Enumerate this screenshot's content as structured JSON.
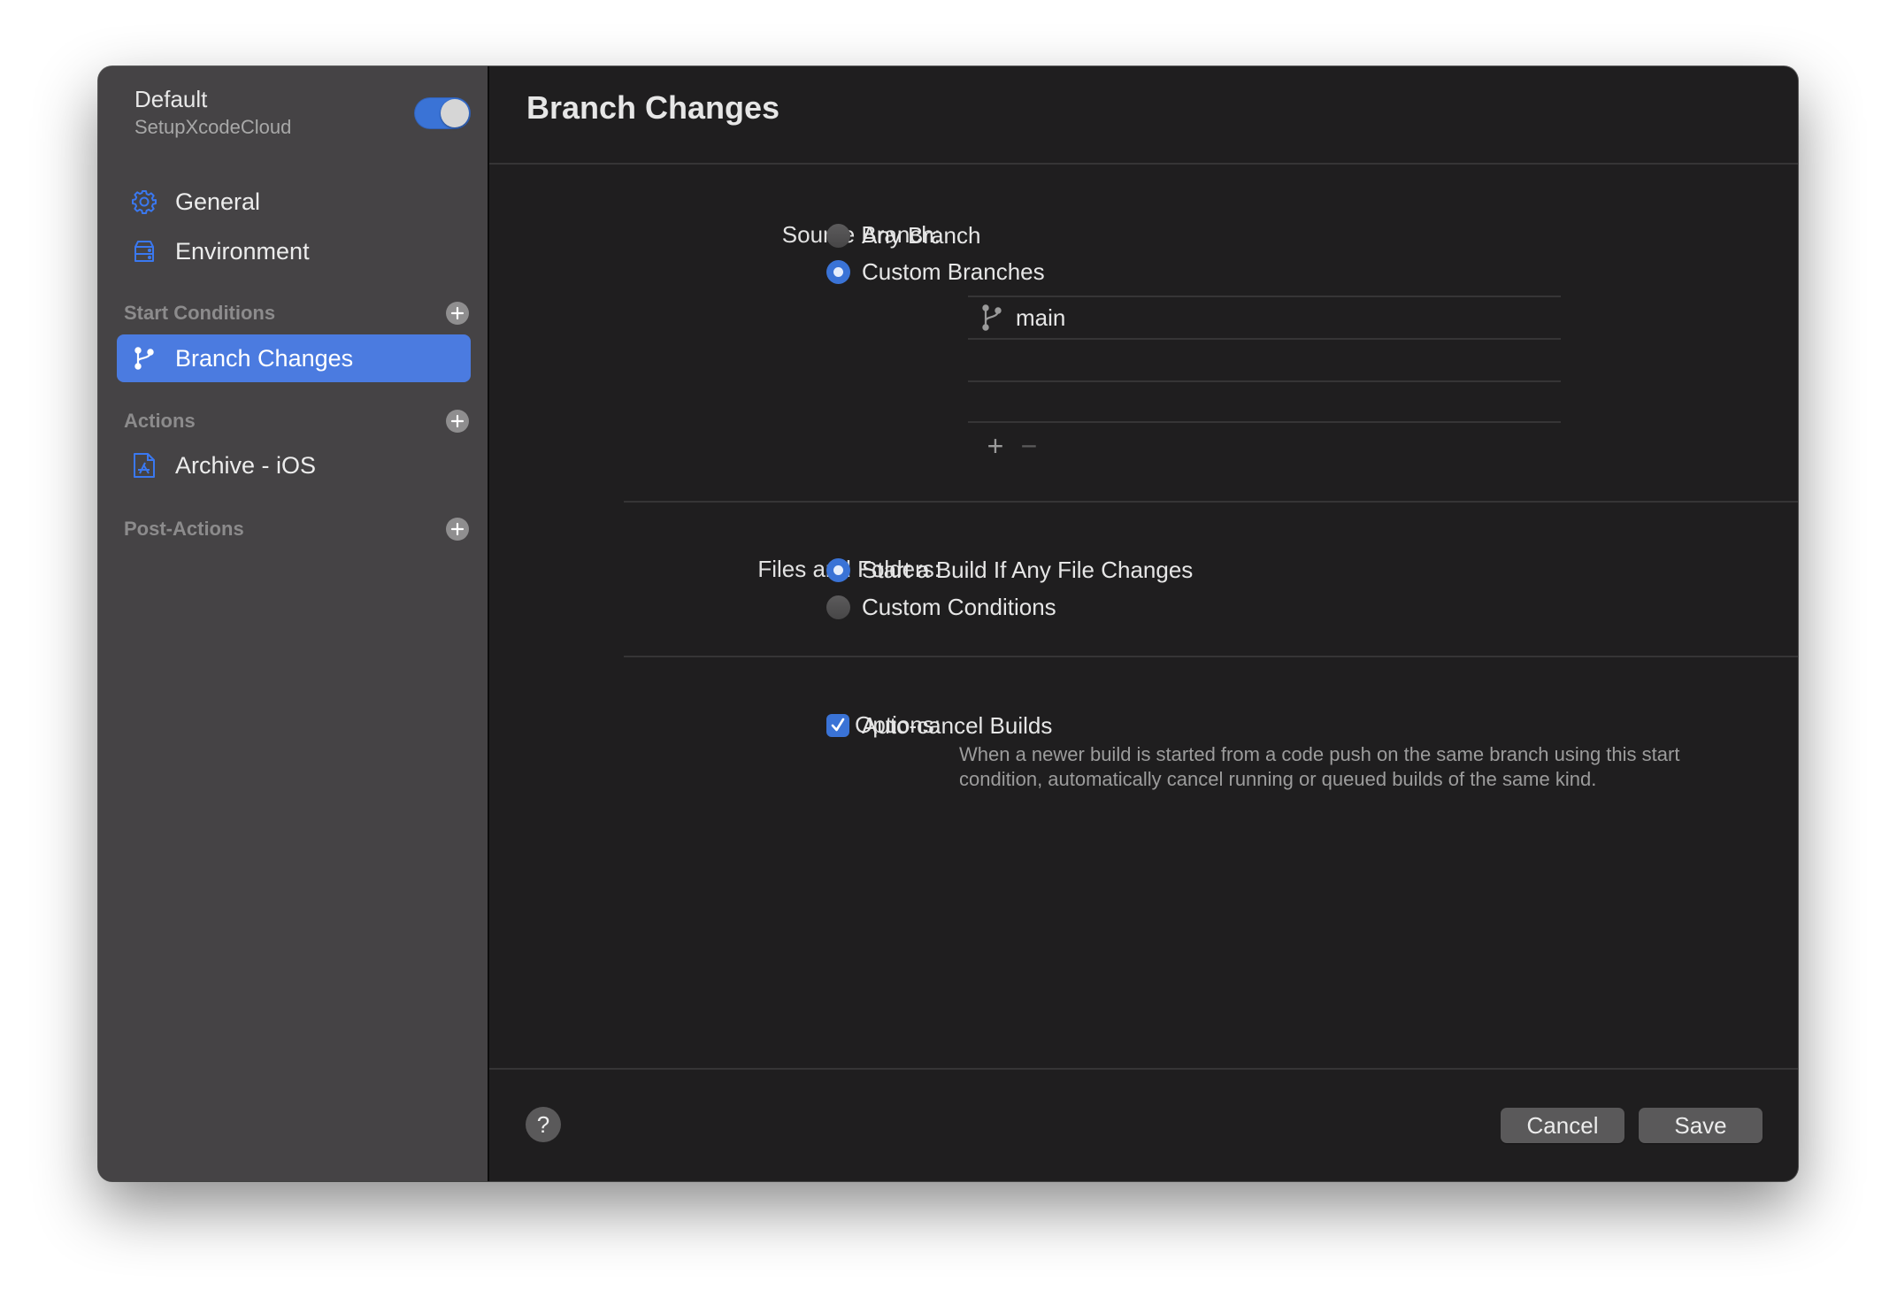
{
  "sidebar": {
    "workflow_name": "Default",
    "product_name": "SetupXcodeCloud",
    "workflow_enabled": true,
    "items": [
      {
        "label": "General",
        "icon": "gear-icon"
      },
      {
        "label": "Environment",
        "icon": "server-icon"
      }
    ],
    "sections": [
      {
        "title": "Start Conditions",
        "items": [
          {
            "label": "Branch Changes",
            "icon": "branch-icon",
            "selected": true
          }
        ]
      },
      {
        "title": "Actions",
        "items": [
          {
            "label": "Archive - iOS",
            "icon": "app-store-document-icon"
          }
        ]
      },
      {
        "title": "Post-Actions",
        "items": []
      }
    ],
    "accent_color": "#4b7be0"
  },
  "main": {
    "title": "Branch Changes",
    "source_branch": {
      "label": "Source Branch:",
      "options": [
        {
          "label": "Any Branch",
          "selected": false
        },
        {
          "label": "Custom Branches",
          "selected": true
        }
      ],
      "branches": [
        "main",
        "",
        ""
      ],
      "add_label": "+",
      "remove_label": "−"
    },
    "files_and_folders": {
      "label": "Files and Folders:",
      "options": [
        {
          "label": "Start a Build If Any File Changes",
          "selected": true
        },
        {
          "label": "Custom Conditions",
          "selected": false
        }
      ]
    },
    "options": {
      "label": "Options:",
      "auto_cancel": {
        "label": "Auto-cancel Builds",
        "checked": true,
        "description": "When a newer build is started from a code push on the same branch using this start condition, automatically cancel running or queued builds of the same kind."
      }
    }
  },
  "footer": {
    "help_label": "?",
    "cancel_label": "Cancel",
    "save_label": "Save"
  }
}
